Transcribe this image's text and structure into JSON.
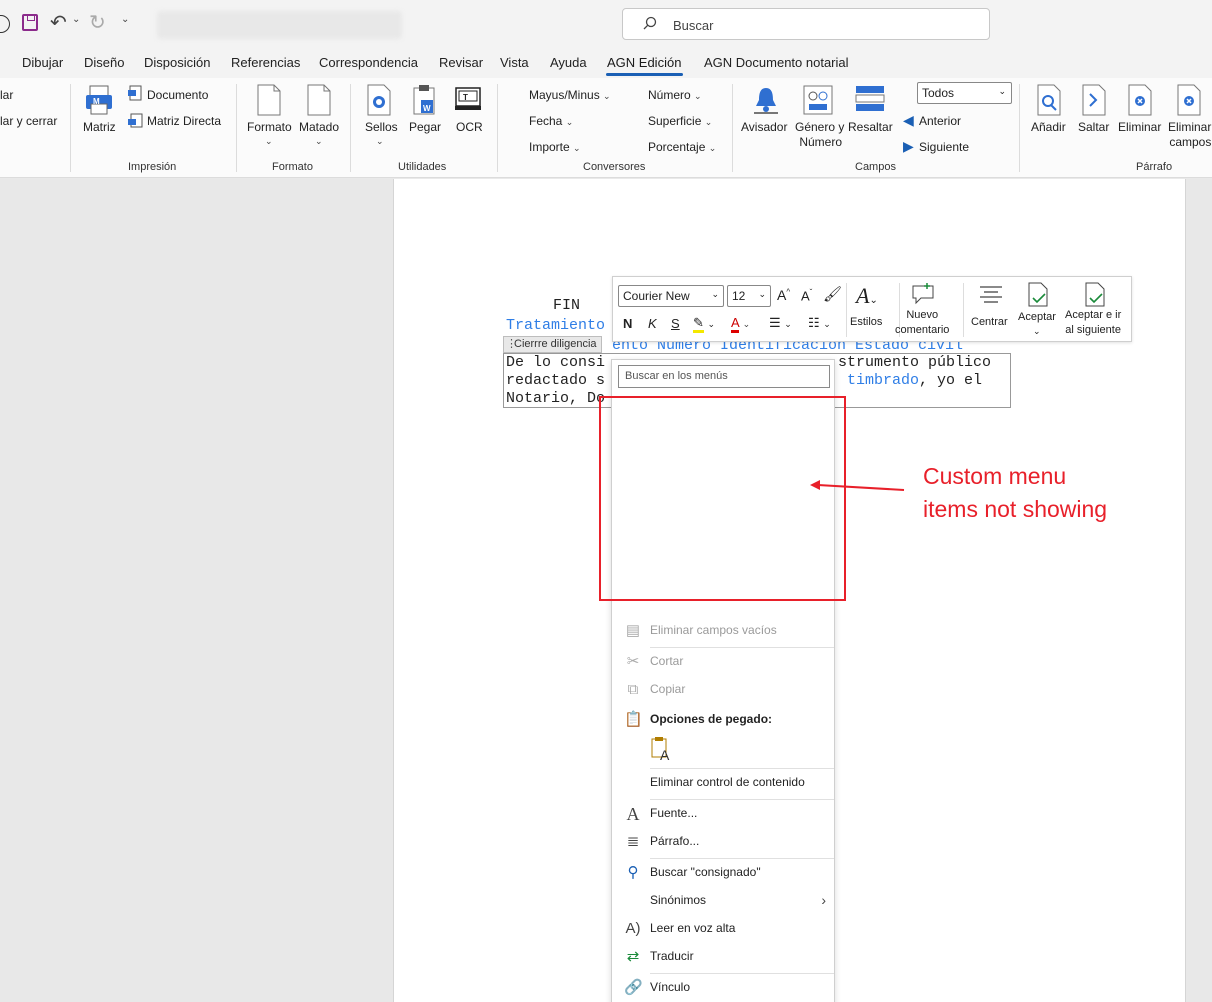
{
  "quick_access": {
    "undo_icon": "undo-icon",
    "redo_icon": "redo-icon",
    "save_icon": "save-icon"
  },
  "search": {
    "label": "Buscar"
  },
  "tabs": [
    {
      "label": "Dibujar"
    },
    {
      "label": "Diseño"
    },
    {
      "label": "Disposición"
    },
    {
      "label": "Referencias"
    },
    {
      "label": "Correspondencia"
    },
    {
      "label": "Revisar"
    },
    {
      "label": "Vista"
    },
    {
      "label": "Ayuda"
    },
    {
      "label": "AGN Edición"
    },
    {
      "label": "AGN Documento notarial"
    }
  ],
  "ribbon": {
    "left_cut": {
      "item1": "lar",
      "item2": "lar y cerrar"
    },
    "impresion": {
      "label": "Impresión",
      "matriz": "Matriz",
      "documento": "Documento",
      "matriz_directa": "Matriz Directa"
    },
    "formato": {
      "label": "Formato",
      "formato": "Formato",
      "matado": "Matado"
    },
    "utilidades": {
      "label": "Utilidades",
      "sellos": "Sellos",
      "pegar": "Pegar",
      "ocr": "OCR"
    },
    "conversores": {
      "label": "Conversores",
      "mayus": "Mayus/Minus",
      "fecha": "Fecha",
      "importe": "Importe",
      "numero": "Número",
      "superficie": "Superficie",
      "porcentaje": "Porcentaje"
    },
    "campos": {
      "label": "Campos",
      "avisador": "Avisador",
      "genero_1": "Género y",
      "genero_2": "Número",
      "resaltar": "Resaltar",
      "select_value": "Todos",
      "anterior": "Anterior",
      "siguiente": "Siguiente"
    },
    "parrafo": {
      "label": "Párrafo",
      "anadir": "Añadir",
      "saltar": "Saltar",
      "eliminar": "Eliminar",
      "eliminar_campos_1": "Eliminar",
      "eliminar_campos_2": "campos"
    }
  },
  "document": {
    "fin": "FIN",
    "tratamiento": "Tratamiento",
    "field_row": "ento Numero Identificacion Estado civil",
    "cc_tag": "Cierrre diligencia",
    "line1_a": "De lo consi",
    "line1_b": "strumento público",
    "line2_a": "redactado s",
    "line2_b": "timbrado",
    "line2_c": ", yo el",
    "line3_a": "Notario, Do"
  },
  "mini_toolbar": {
    "font_name": "Courier New",
    "font_size": "12",
    "bold": "N",
    "italic": "K",
    "strike": "S",
    "estilos": "Estilos",
    "nuevo_1": "Nuevo",
    "nuevo_2": "comentario",
    "centrar": "Centrar",
    "aceptar": "Aceptar",
    "aceptar_ir_1": "Aceptar e ir",
    "aceptar_ir_2": "al siguiente"
  },
  "context_menu": {
    "search_placeholder": "Buscar en los menús",
    "items": {
      "eliminar_campos_vacios": "Eliminar campos vacíos",
      "cortar": "Cortar",
      "copiar": "Copiar",
      "opciones_pegado": "Opciones de pegado:",
      "eliminar_control": "Eliminar control de contenido",
      "fuente": "Fuente...",
      "parrafo": "Párrafo...",
      "buscar": "Buscar \"consignado\"",
      "sinonimos": "Sinónimos",
      "leer": "Leer en voz alta",
      "traducir": "Traducir",
      "vinculo": "Vínculo"
    }
  },
  "annotation": {
    "line1": "Custom menu",
    "line2": "items not showing",
    "color": "#e8202a"
  },
  "colors": {
    "accent_tab": "#1a5fb4",
    "field_blue": "#2f7ee6",
    "save_purple": "#8b2a8b"
  }
}
